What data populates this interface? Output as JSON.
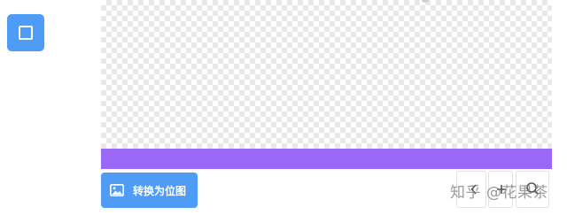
{
  "toolbar": {
    "shape_tool_icon": "square-icon"
  },
  "canvas": {
    "background_pattern": "transparency-checkerboard",
    "band_color": "#9a68f6"
  },
  "actions": {
    "convert_label": "转换为位图",
    "convert_icon": "image-icon",
    "button_color": "#4f9cf7"
  },
  "controls": {
    "left_icon": "chevron-left-icon",
    "middle_icon": "plus-icon",
    "right_icon": "zoom-icon"
  },
  "watermark": {
    "text": "知乎 @花果茶"
  }
}
